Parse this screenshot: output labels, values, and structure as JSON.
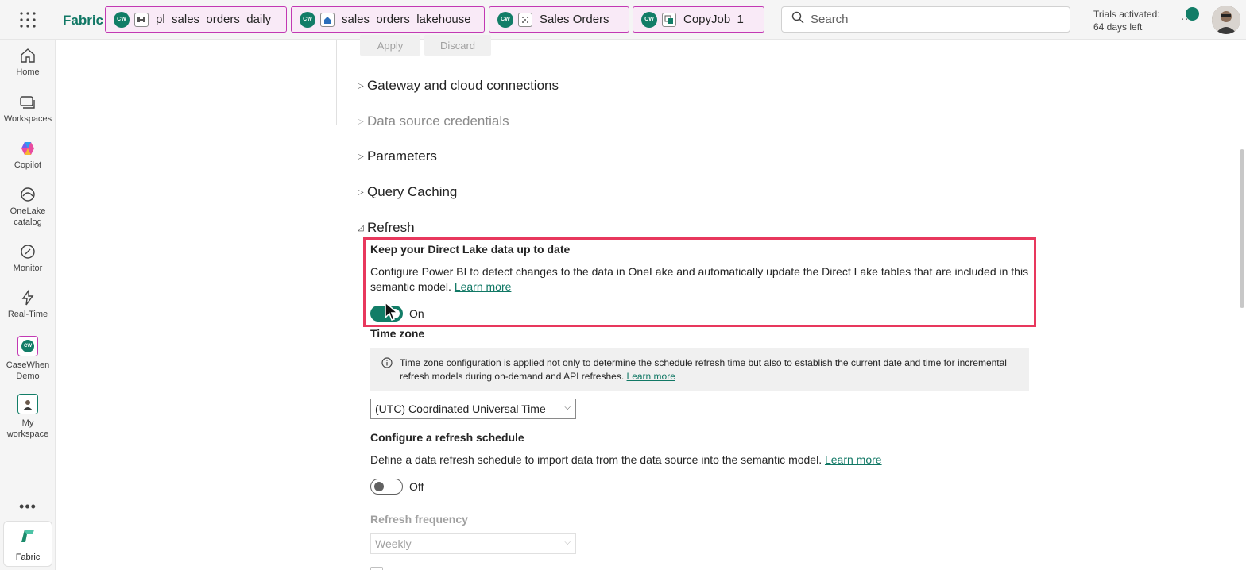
{
  "app": {
    "brand": "Fabric",
    "theme_color": "#117865"
  },
  "tabs": [
    {
      "label": "pl_sales_orders_daily",
      "workspace_badge": "CW",
      "icon": "pipeline-icon"
    },
    {
      "label": "sales_orders_lakehouse",
      "workspace_badge": "CW",
      "icon": "lakehouse-icon"
    },
    {
      "label": "Sales Orders",
      "workspace_badge": "CW",
      "icon": "semantic-model-icon"
    },
    {
      "label": "CopyJob_1",
      "workspace_badge": "CW",
      "icon": "copy-job-icon"
    }
  ],
  "search": {
    "placeholder": "Search"
  },
  "trial": {
    "line1": "Trials activated:",
    "line2": "64 days left"
  },
  "topbar": {
    "more": "…"
  },
  "rail": {
    "items": [
      {
        "label": "Home",
        "icon": "home-icon"
      },
      {
        "label": "Workspaces",
        "icon": "workspaces-icon"
      },
      {
        "label": "Copilot",
        "icon": "copilot-icon"
      },
      {
        "label": "OneLake catalog",
        "icon": "onelake-icon"
      },
      {
        "label": "Monitor",
        "icon": "monitor-icon"
      },
      {
        "label": "Real-Time",
        "icon": "lightning-icon"
      },
      {
        "label": "CaseWhen Demo",
        "icon": "workspace-icon"
      },
      {
        "label": "My workspace",
        "icon": "my-workspace-icon"
      }
    ],
    "more": "•••",
    "switcher_label": "Fabric"
  },
  "actions": {
    "apply": "Apply",
    "discard": "Discard"
  },
  "sections": [
    {
      "title": "Gateway and cloud connections",
      "expanded": false,
      "disabled": false
    },
    {
      "title": "Data source credentials",
      "expanded": false,
      "disabled": true
    },
    {
      "title": "Parameters",
      "expanded": false,
      "disabled": false
    },
    {
      "title": "Query Caching",
      "expanded": false,
      "disabled": false
    },
    {
      "title": "Refresh",
      "expanded": true,
      "disabled": false
    }
  ],
  "refresh": {
    "direct_lake": {
      "title": "Keep your Direct Lake data up to date",
      "description": "Configure Power BI to detect changes to the data in OneLake and automatically update the Direct Lake tables that are included in this semantic model.",
      "learn_more": "Learn more",
      "toggle_state": "On",
      "toggle_on": true
    },
    "time_zone": {
      "title": "Time zone",
      "info": "Time zone configuration is applied not only to determine the schedule refresh time but also to establish the current date and time for incremental refresh models during on-demand and API refreshes.",
      "learn_more": "Learn more",
      "selected": "(UTC) Coordinated Universal Time"
    },
    "schedule": {
      "title": "Configure a refresh schedule",
      "description": "Define a data refresh schedule to import data from the data source into the semantic model.",
      "learn_more": "Learn more",
      "toggle_state": "Off",
      "toggle_on": false
    },
    "frequency": {
      "title": "Refresh frequency",
      "selected": "Weekly"
    }
  },
  "colors": {
    "highlight_border": "#e8385d",
    "toggle_on": "#127d67",
    "tab_border": "#c239b3"
  }
}
